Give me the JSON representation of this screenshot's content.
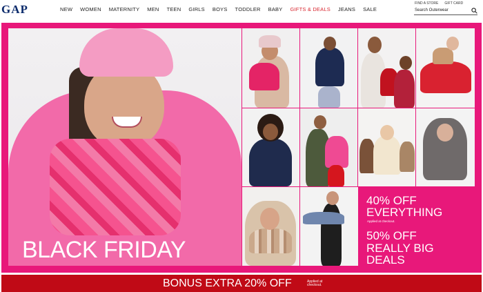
{
  "header": {
    "logo": "GAP",
    "nav": [
      "NEW",
      "WOMEN",
      "MATERNITY",
      "MEN",
      "TEEN",
      "GIRLS",
      "BOYS",
      "TODDLER",
      "BABY",
      "GIFTS & DEALS",
      "JEANS",
      "SALE"
    ],
    "util_links": [
      "FIND A STORE",
      "GIFT CARD"
    ],
    "search_text": "Search Outerwear"
  },
  "hero": {
    "headline": "BLACK FRIDAY",
    "promo": {
      "line1": "40% OFF",
      "line2": "EVERYTHING",
      "note": "Applied at checkout.",
      "line3": "50% OFF",
      "line4": "REALLY BIG DEALS"
    },
    "accent_color": "#e8187a"
  },
  "bonus": {
    "text": "BONUS EXTRA 20% OFF",
    "note": "Applied at checkout.",
    "color": "#c00a16"
  }
}
